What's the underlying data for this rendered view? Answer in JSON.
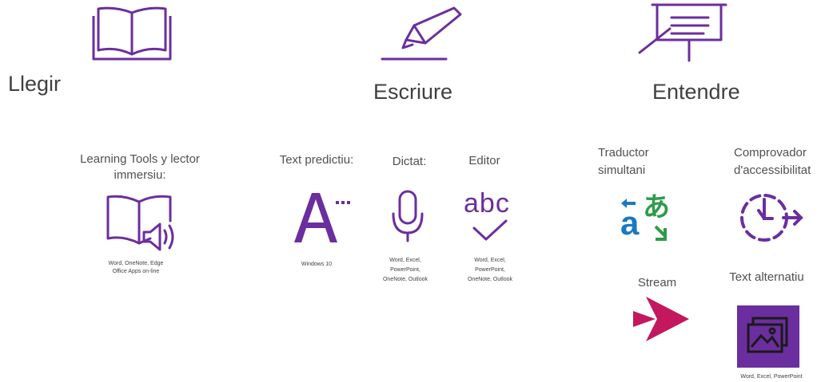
{
  "sections": {
    "read": {
      "title": "Llegir"
    },
    "write": {
      "title": "Escriure"
    },
    "understand": {
      "title": "Entendre"
    }
  },
  "tools": {
    "learning_tools": {
      "label": "Learning Tools y lector immersiu:",
      "apps_line1": "Word, OneNote, Edge",
      "apps_line2": "Office Apps on-line"
    },
    "text_prediction": {
      "label": "Text predictiu:",
      "apps": "Windows 10"
    },
    "dictation": {
      "label": "Dictat:",
      "apps_line1": "Word, Excel,",
      "apps_line2": "PowerPoint,",
      "apps_line3": "OneNote, Outlook"
    },
    "editor": {
      "label": "Editor",
      "glyph": "abc",
      "apps_line1": "Word, Excel,",
      "apps_line2": "PowerPoint,",
      "apps_line3": "OneNote, Outlook"
    },
    "translator": {
      "label_line1": "Traductor",
      "label_line2": "simultani",
      "glyph_a": "a",
      "glyph_jp": "あ"
    },
    "accessibility_checker": {
      "label_line1": "Comprovador",
      "label_line2": "d'accessibilitat"
    },
    "stream": {
      "label": "Stream"
    },
    "alt_text": {
      "label": "Text alternatiu",
      "apps": "Word, Excel, PowerPoint"
    }
  },
  "colors": {
    "purple": "#6b2e9e",
    "translator_blue": "#1a78c2",
    "translator_green": "#2e9b4a",
    "stream_magenta": "#c3185d",
    "text": "#505050"
  },
  "icons": [
    "book-icon",
    "pen-icon",
    "presentation-board-icon",
    "immersive-reader-icon",
    "text-prediction-icon",
    "microphone-icon",
    "editor-check-icon",
    "translator-icon",
    "accessibility-checker-icon",
    "stream-icon",
    "alt-text-icon"
  ]
}
